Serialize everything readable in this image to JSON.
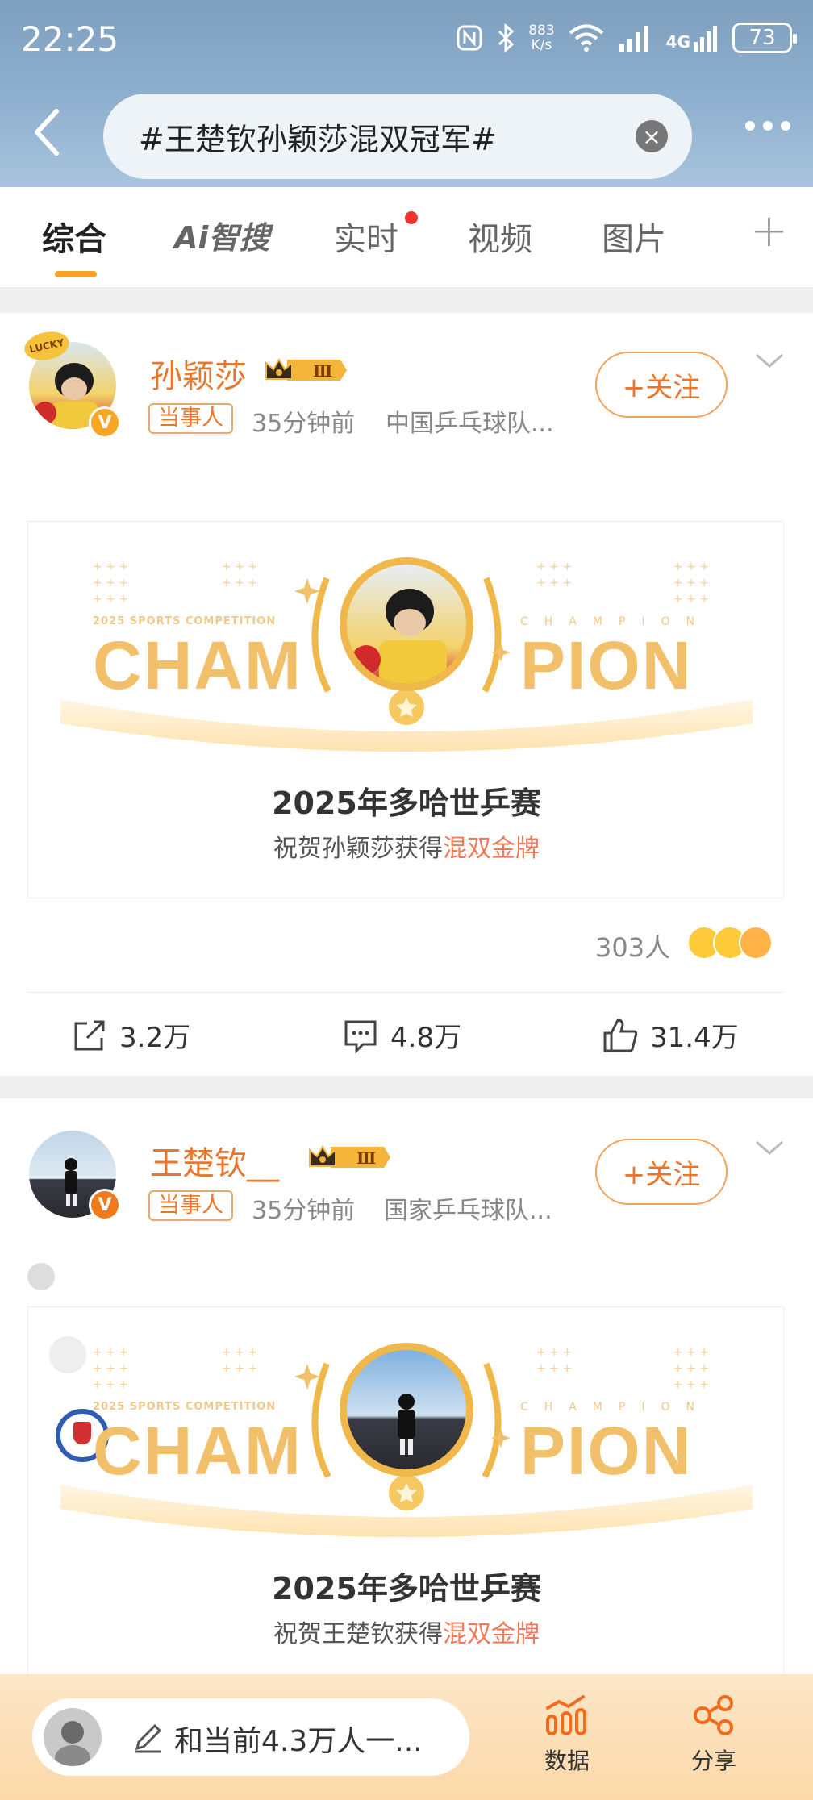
{
  "status_bar": {
    "time": "22:25",
    "network_speed_top": "883",
    "network_speed_bottom": "K/s",
    "network_type": "4G",
    "battery": "73"
  },
  "search": {
    "query": "#王楚钦孙颖莎混双冠军#"
  },
  "tabs": [
    {
      "label": "综合",
      "active": true
    },
    {
      "label": "Ai智搜",
      "active": false
    },
    {
      "label": "实时",
      "active": false,
      "has_dot": true
    },
    {
      "label": "视频",
      "active": false
    },
    {
      "label": "图片",
      "active": false
    }
  ],
  "colors": {
    "accent": "#e8772d",
    "tab_underline": "#f7a12b",
    "header_bg": "#8fb0cf",
    "highlight": "#ee7a5a"
  },
  "posts": [
    {
      "username": "孙颖莎",
      "tag": "当事人",
      "time": "35分钟前",
      "source": "中国乒乓球队...",
      "follow_label": "+关注",
      "avatar_badge": "LUCKY",
      "banner": {
        "competition": "2025 SPORTS COMPETITION",
        "champion_spaced": "CHAMPION",
        "cham": "CHAM",
        "pion": "PION",
        "title": "2025年多哈世乒赛",
        "sub_prefix": "祝贺孙颖莎获得",
        "sub_highlight": "混双金牌"
      },
      "reaction_count": "303人",
      "reposts": "3.2万",
      "comments": "4.8万",
      "likes": "31.4万"
    },
    {
      "username": "王楚钦__",
      "tag": "当事人",
      "time": "35分钟前",
      "source": "国家乒乓球队...",
      "follow_label": "+关注",
      "banner": {
        "competition": "2025 SPORTS COMPETITION",
        "champion_spaced": "CHAMPION",
        "cham": "CHAM",
        "pion": "PION",
        "title": "2025年多哈世乒赛",
        "sub_prefix": "祝贺王楚钦获得",
        "sub_highlight": "混双金牌"
      }
    }
  ],
  "bottom_bar": {
    "comment_placeholder": "和当前4.3万人一...",
    "data_label": "数据",
    "share_label": "分享"
  }
}
